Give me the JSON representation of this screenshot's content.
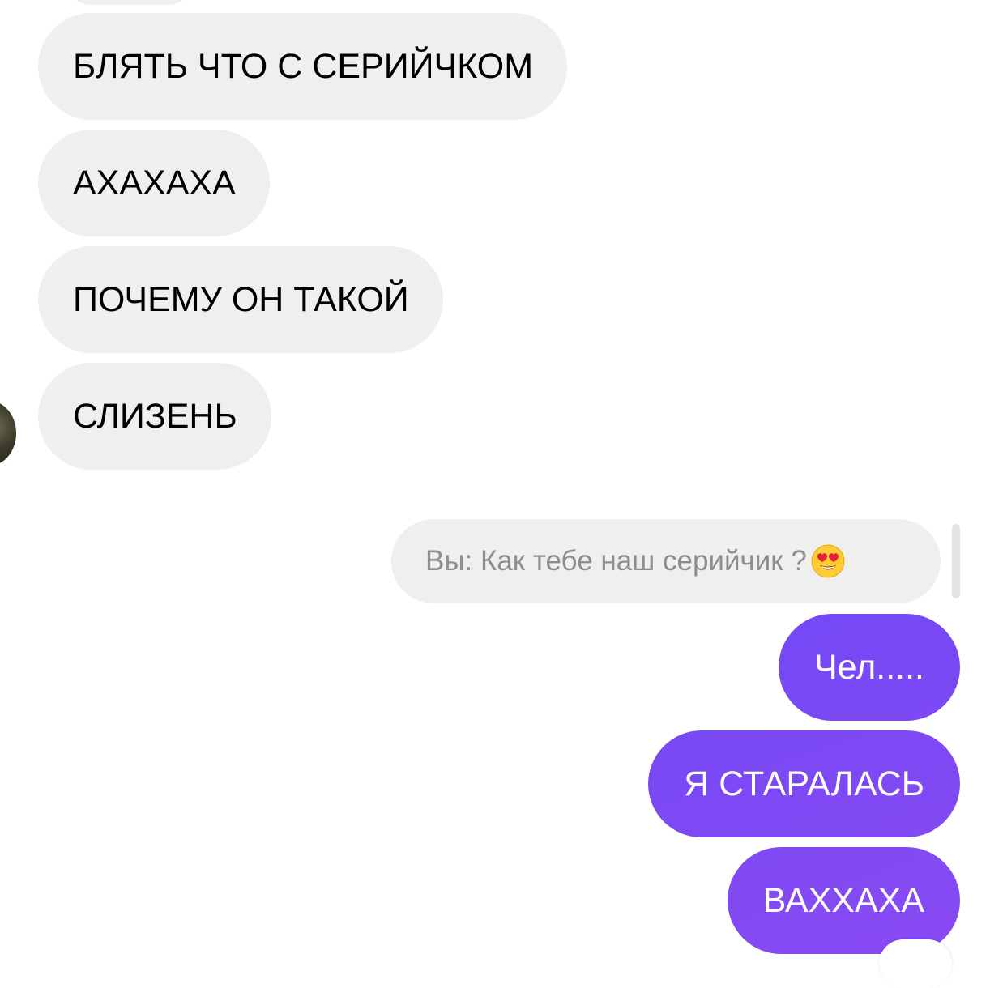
{
  "conversation": {
    "incoming": [
      {
        "text": "БЛЯТЬ ЧТО С СЕРИЙЧКОМ"
      },
      {
        "text": "АХАХАХА"
      },
      {
        "text": "ПОЧЕМУ ОН ТАКОЙ"
      },
      {
        "text": "СЛИЗЕНЬ"
      }
    ],
    "reply_quote": {
      "text": "Вы: Как тебе наш серийчик ?",
      "emoji": "heart-eyes-emoji"
    },
    "outgoing": [
      {
        "text": "Чел....."
      },
      {
        "text": "Я СТАРАЛАСЬ"
      },
      {
        "text": "ВАХХАХА"
      }
    ]
  },
  "colors": {
    "incoming_bubble": "#efefef",
    "outgoing_gradient_start": "#4457f7",
    "outgoing_gradient_end": "#8a4af3",
    "quote_text": "#8e8e8e"
  }
}
